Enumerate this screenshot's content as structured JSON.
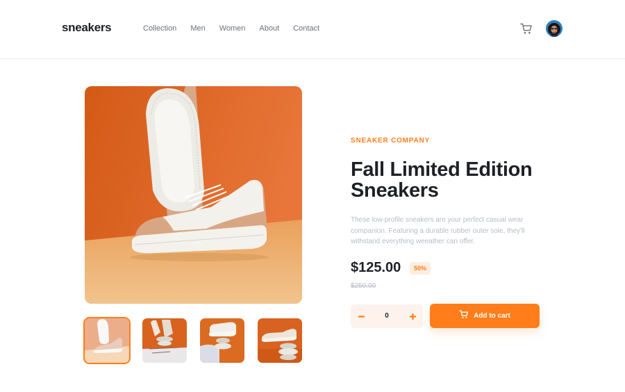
{
  "header": {
    "logo": "sneakers",
    "nav": [
      "Collection",
      "Men",
      "Women",
      "About",
      "Contact"
    ]
  },
  "gallery": {
    "thumbnails": [
      "thumbnail-1",
      "thumbnail-2",
      "thumbnail-3",
      "thumbnail-4"
    ],
    "active_index": 0
  },
  "product": {
    "company": "SNEAKER COMPANY",
    "title": "Fall Limited Edition Sneakers",
    "description": "These low-profile sneakers are your perfect casual wear companion. Featuring a durable rubber outer sole, they'll withstand everything weeather can offer.",
    "price": "$125.00",
    "discount": "50%",
    "original_price": "$250.00"
  },
  "cart": {
    "quantity": "0",
    "add_label": "Add to cart"
  },
  "colors": {
    "accent": "#ff7e1b",
    "accent_pale": "#ffede0",
    "text_dark": "#1d2026",
    "text_muted": "#b6bcc8"
  }
}
